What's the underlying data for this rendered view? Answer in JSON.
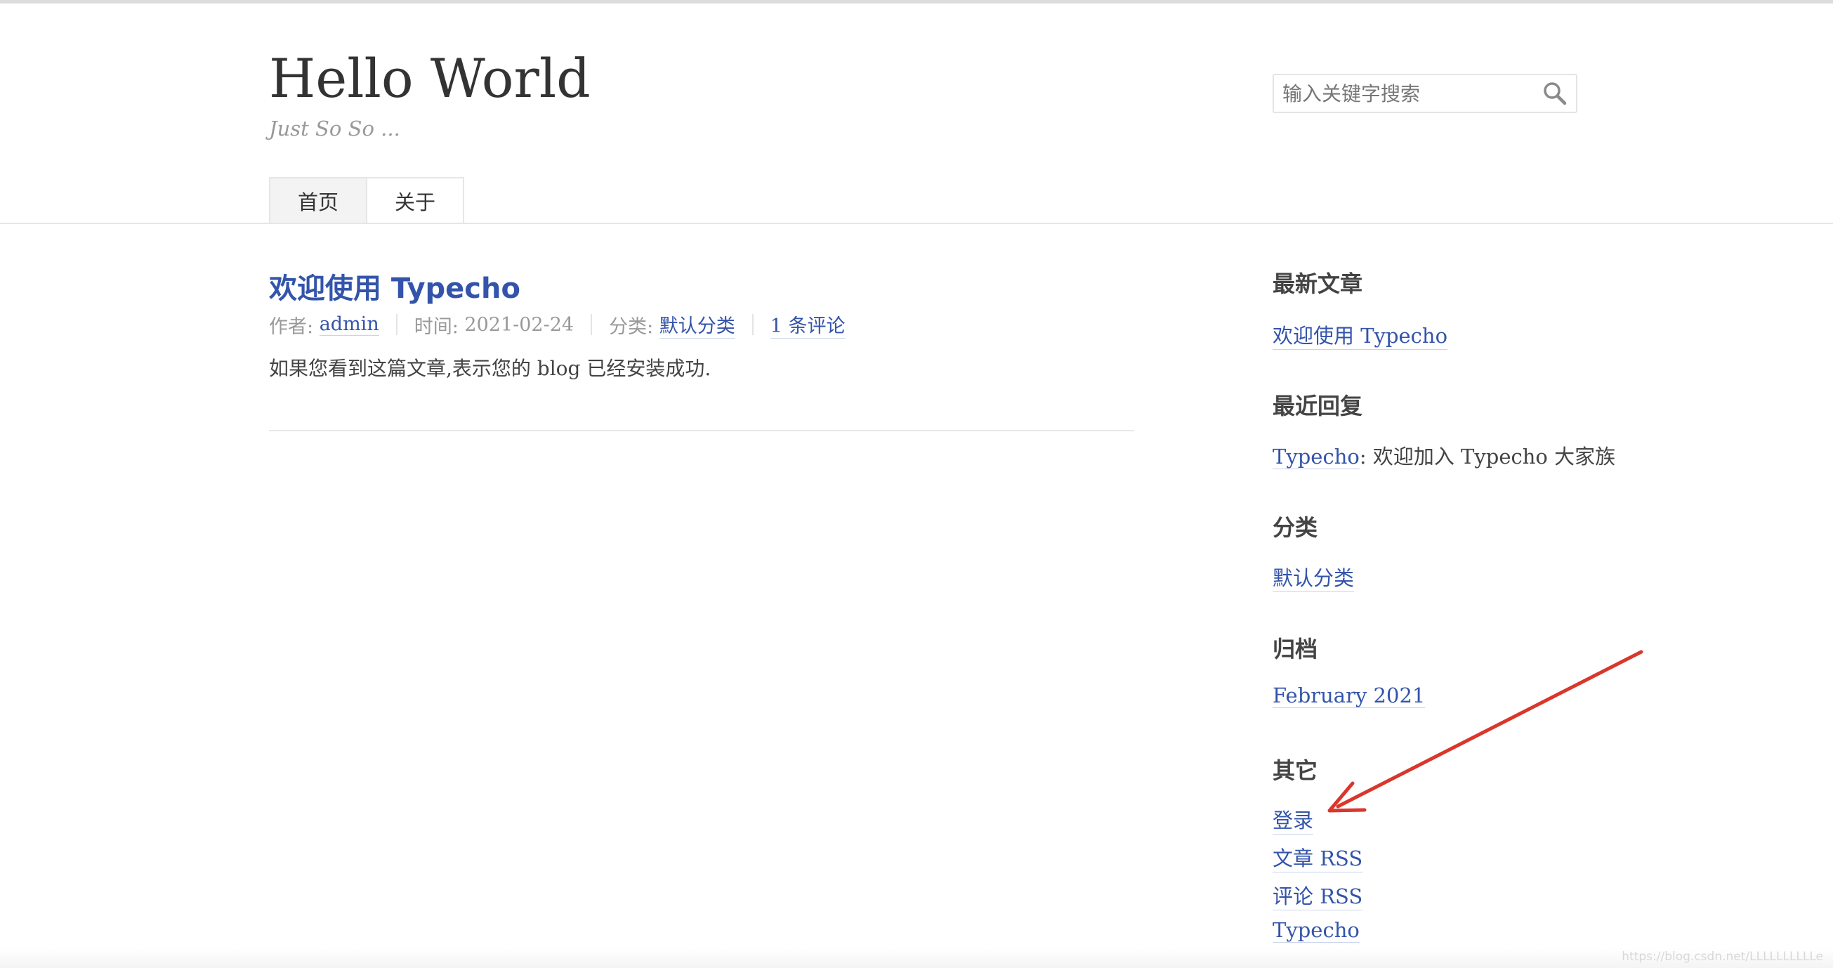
{
  "site": {
    "title": "Hello World",
    "description": "Just So So ..."
  },
  "search": {
    "placeholder": "输入关键字搜索"
  },
  "nav": {
    "items": [
      {
        "label": "首页"
      },
      {
        "label": "关于"
      }
    ]
  },
  "post": {
    "title": "欢迎使用 Typecho",
    "author_label": "作者:",
    "author": "admin",
    "date_label": "时间:",
    "date": "2021-02-24",
    "category_label": "分类:",
    "category": "默认分类",
    "comments": "1 条评论",
    "excerpt": "如果您看到这篇文章,表示您的 blog 已经安装成功."
  },
  "sidebar": {
    "recent_posts": {
      "title": "最新文章",
      "items": [
        "欢迎使用 Typecho"
      ]
    },
    "recent_comments": {
      "title": "最近回复",
      "author": "Typecho",
      "text": ": 欢迎加入 Typecho 大家族"
    },
    "categories": {
      "title": "分类",
      "items": [
        "默认分类"
      ]
    },
    "archives": {
      "title": "归档",
      "items": [
        "February 2021"
      ]
    },
    "other": {
      "title": "其它",
      "items": [
        "登录",
        "文章 RSS",
        "评论 RSS",
        "Typecho"
      ]
    }
  },
  "annotation": {
    "arrow_color": "#d9372b"
  },
  "watermark": "https://blog.csdn.net/LLLLLLLLLLe",
  "colors": {
    "link": "#3354aa",
    "text": "#444444"
  }
}
